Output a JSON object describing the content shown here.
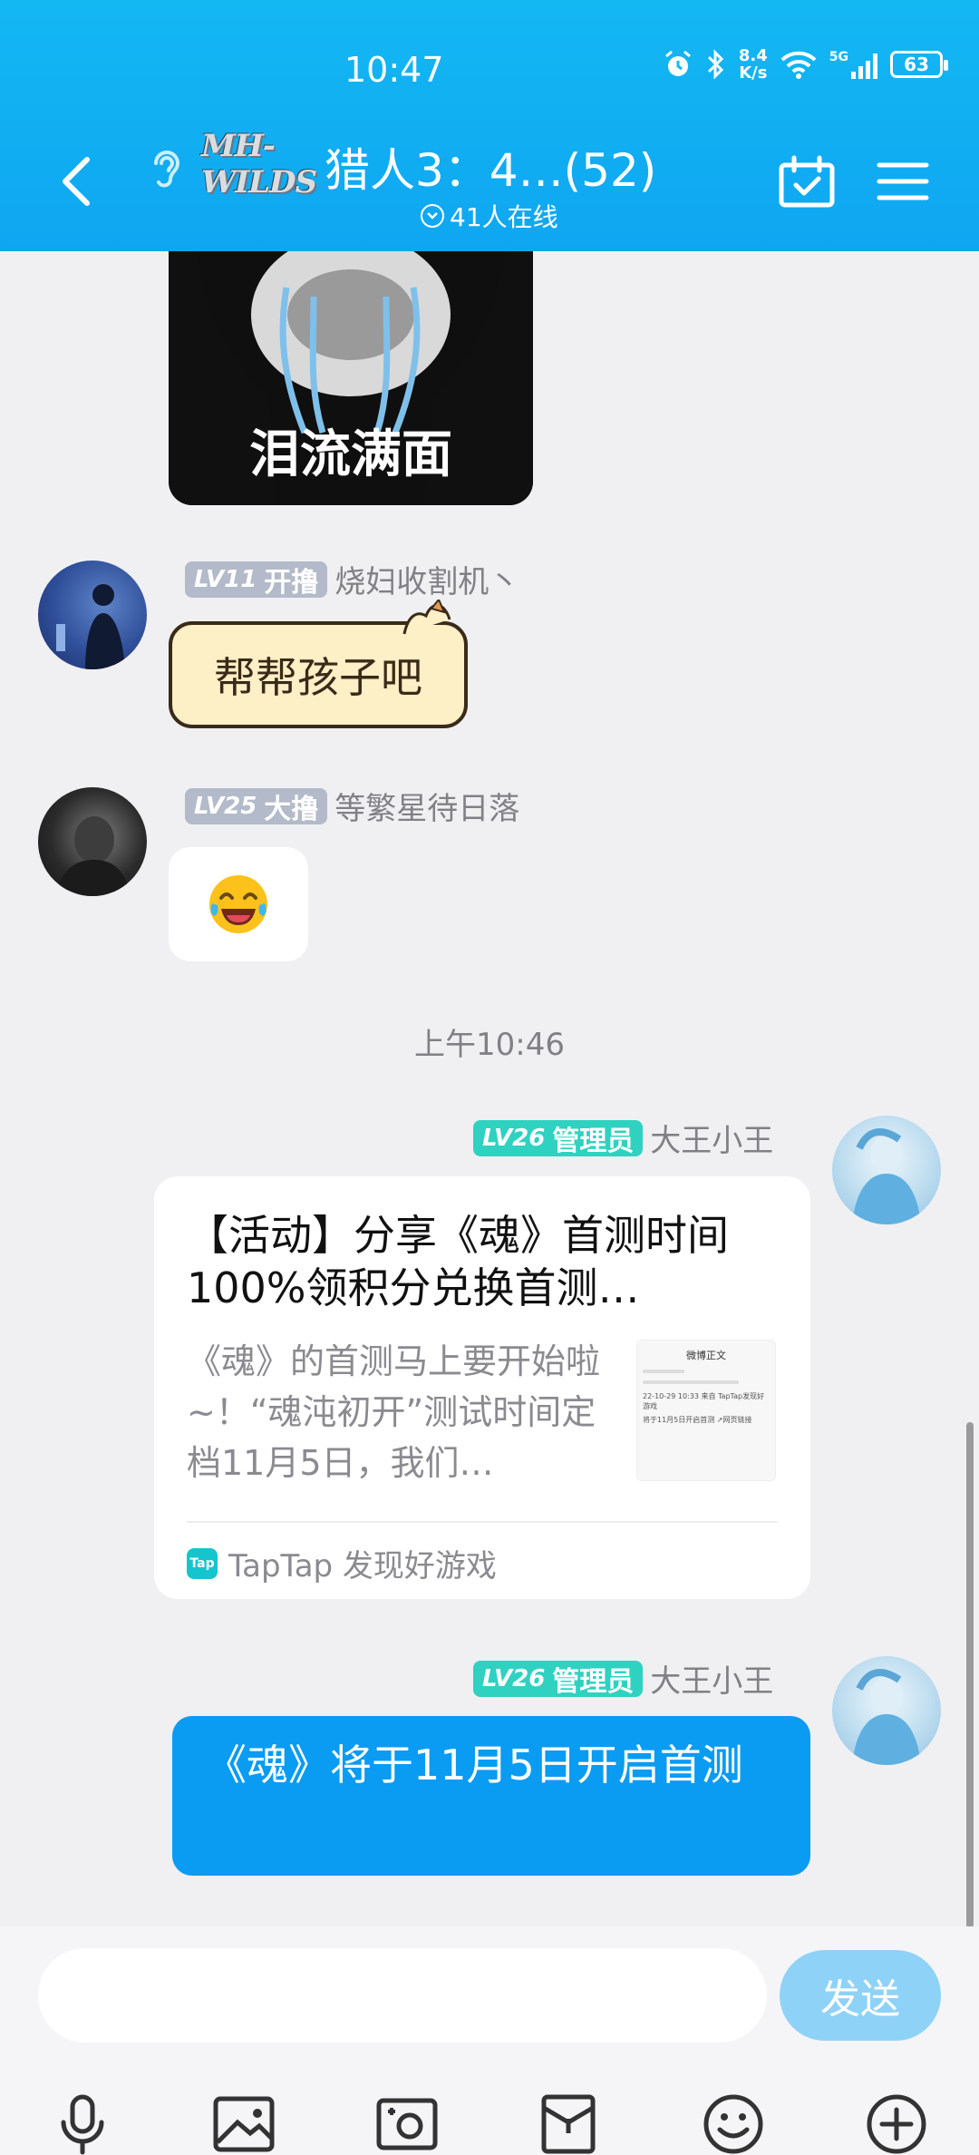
{
  "status_bar": {
    "time": "10:47",
    "net_speed_value": "8.4",
    "net_speed_unit": "K/s",
    "signal_label": "5G",
    "battery": "63"
  },
  "header": {
    "group_logo_text": "MH-WILDS",
    "group_title": "猎人3：4…(52)",
    "online_text": "41人在线"
  },
  "messages": {
    "sticker_caption": "泪流满面",
    "msg1": {
      "level": "LV11",
      "rank": "开撸",
      "sender": "烧妇收割机丶",
      "text": "帮帮孩子吧"
    },
    "msg2": {
      "level": "LV25",
      "rank": "大撸",
      "sender": "等繁星待日落",
      "emoji": "😂"
    },
    "timestamp": "上午10:46",
    "msg3": {
      "level": "LV26",
      "rank": "管理员",
      "sender": "大王小王",
      "card_title": "【活动】分享《魂》首测时间 100%领积分兑换首测…",
      "card_desc": "《魂》的首测马上要开始啦~！“魂沌初开”测试时间定档11月5日，我们…",
      "thumb_title": "微博正文",
      "thumb_line1": "22-10-29 10:33 来自 TapTap发现好游戏",
      "thumb_line2": "将于11月5日开启首测 ↗网页链接",
      "source_logo": "Tap",
      "source": "TapTap 发现好游戏"
    },
    "msg4": {
      "level": "LV26",
      "rank": "管理员",
      "sender": "大王小王",
      "text": "《魂》将于11月5日开启首测"
    }
  },
  "input": {
    "value": "",
    "placeholder": ""
  },
  "send_label": "发送",
  "colors": {
    "header": "#13b8f3",
    "accent_blue": "#0a9bf3",
    "badge_teal": "#2fd2c0",
    "badge_gray": "#b3bac9",
    "send_disabled": "#8fd2f7"
  },
  "toolbar_icons": [
    "microphone-icon",
    "photo-icon",
    "camera-icon",
    "red-envelope-icon",
    "emoji-icon",
    "plus-icon"
  ]
}
